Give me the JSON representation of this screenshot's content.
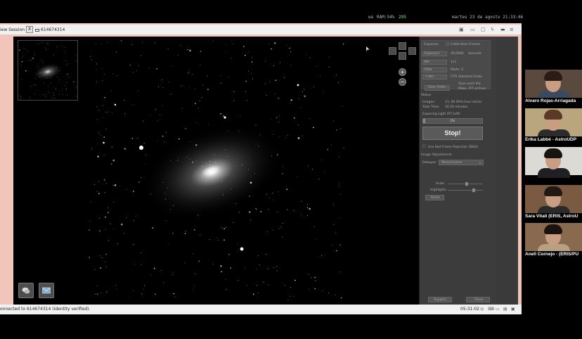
{
  "system_bar": {
    "keyboard": "us",
    "ram": "RAM:54%",
    "network": "295",
    "datetime": "martes 23 de agosto 21:33:46"
  },
  "remote_window": {
    "tab_view_session": "iew Session",
    "tab_close": "X",
    "tab_session_id": "614674314",
    "toolbar_icons": [
      "screenshot-icon",
      "window-icon",
      "monitor-icon",
      "lightning-icon",
      "minimize-icon",
      "menu-icon"
    ]
  },
  "capture_panel": {
    "section_top": {
      "label_a": "Exposure",
      "radio_label": "Calibration Frames",
      "field1_label": "Exposure",
      "field1_value": "30.0000",
      "field1_unit": "Seconds",
      "field2_label": "Bin",
      "field2_value": "1x1",
      "field3_label": "Filter",
      "field3_value": "Mode: 2",
      "field4_value": "-1 Bin",
      "checkbox1": "FITS Standard Scale",
      "checkbox2": "Save each file",
      "checkbox3": "Make .FIT archive",
      "save_button": "Save Folde..."
    },
    "status": {
      "heading": "Status",
      "images_label": "Images:",
      "images_value": "11, 60.00% hour remai",
      "total_time_label": "Total Time:",
      "total_time_value": "16.50 minutes",
      "exposing_label": "Exposing Light (97 Left)",
      "progress_text": "3%",
      "progress_fraction": 0.03
    },
    "stop_button": "Stop!",
    "bad_frame_checkbox": "Use Bad Frame Rejection (B&D)",
    "adjustments": {
      "heading": "Image Adjustments",
      "debayer_label": "Debayer:",
      "debayer_value": "Monochrome",
      "scale_label": "Scale",
      "highlights_label": "Highlights",
      "scale_level": 0.55,
      "highlights_level": 0.75,
      "reset_button": "Reset"
    },
    "support_button": "Support...",
    "close_button": "Close"
  },
  "status_bar": {
    "connection_text": "onnected to 614674314 (identity verified).",
    "elapsed": "05:31:02"
  },
  "participants": [
    {
      "name": "Alvaro Rojas-Arriagada",
      "bg": "#5a4a3e",
      "hair": "#2a1c15",
      "shirt": "#3b4a5e"
    },
    {
      "name": "Erika Labbé - AstroUDP",
      "bg": "#b9a67e",
      "hair": "#5a3a24",
      "shirt": "#2c2c2c"
    },
    {
      "name": "",
      "bg": "#dcdad4",
      "hair": "#1a1410",
      "shirt": "#1f1f24"
    },
    {
      "name": "Sara Vitali (ERIS, AstroU",
      "bg": "#7a5a40",
      "hair": "#221814",
      "shirt": "#2a2a2a"
    },
    {
      "name": "Anell Cornejo - (ERIS/PU",
      "bg": "#8a6a4e",
      "hair": "#1a120e",
      "shirt": "#b8a080"
    }
  ]
}
